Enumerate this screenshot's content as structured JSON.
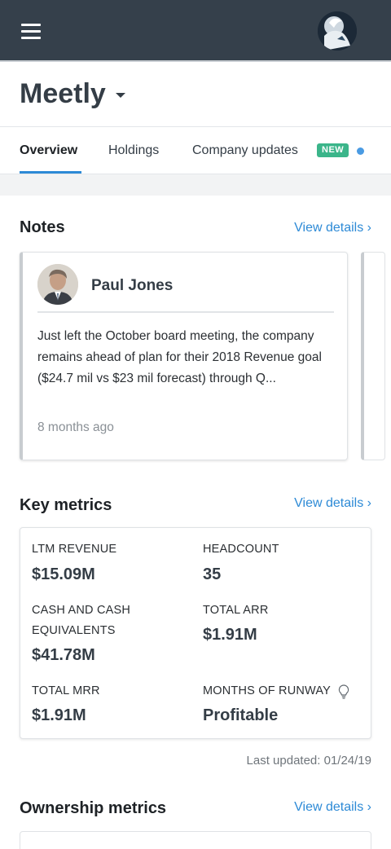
{
  "header": {
    "menu_icon": "hamburger-menu-icon",
    "avatar_icon": "user-avatar"
  },
  "company": {
    "name": "Meetly"
  },
  "tabs": [
    {
      "label": "Overview",
      "active": true
    },
    {
      "label": "Holdings",
      "active": false
    },
    {
      "label": "Company updates",
      "active": false,
      "badge": "NEW"
    }
  ],
  "notes": {
    "title": "Notes",
    "view_link": "View details ›",
    "card": {
      "author": "Paul Jones",
      "body": "Just left the October board meeting, the company remains ahead of plan for their 2018 Revenue goal ($24.7 mil vs $23 mil forecast) through Q...",
      "time": "8 months ago"
    }
  },
  "key_metrics": {
    "title": "Key metrics",
    "view_link": "View details ›",
    "items": [
      {
        "label": "LTM REVENUE",
        "value": "$15.09M"
      },
      {
        "label": "HEADCOUNT",
        "value": "35"
      },
      {
        "label": "CASH AND CASH EQUIVALENTS",
        "value": "$41.78M"
      },
      {
        "label": "TOTAL ARR",
        "value": "$1.91M"
      },
      {
        "label": "TOTAL MRR",
        "value": "$1.91M"
      },
      {
        "label": "MONTHS OF RUNWAY",
        "value": "Profitable"
      }
    ],
    "last_updated": "Last updated: 01/24/19"
  },
  "ownership": {
    "title": "Ownership metrics",
    "view_link": "View details ›"
  },
  "colors": {
    "topbar": "#35404b",
    "accent": "#2d8ad6",
    "badge": "#3bb58a"
  }
}
